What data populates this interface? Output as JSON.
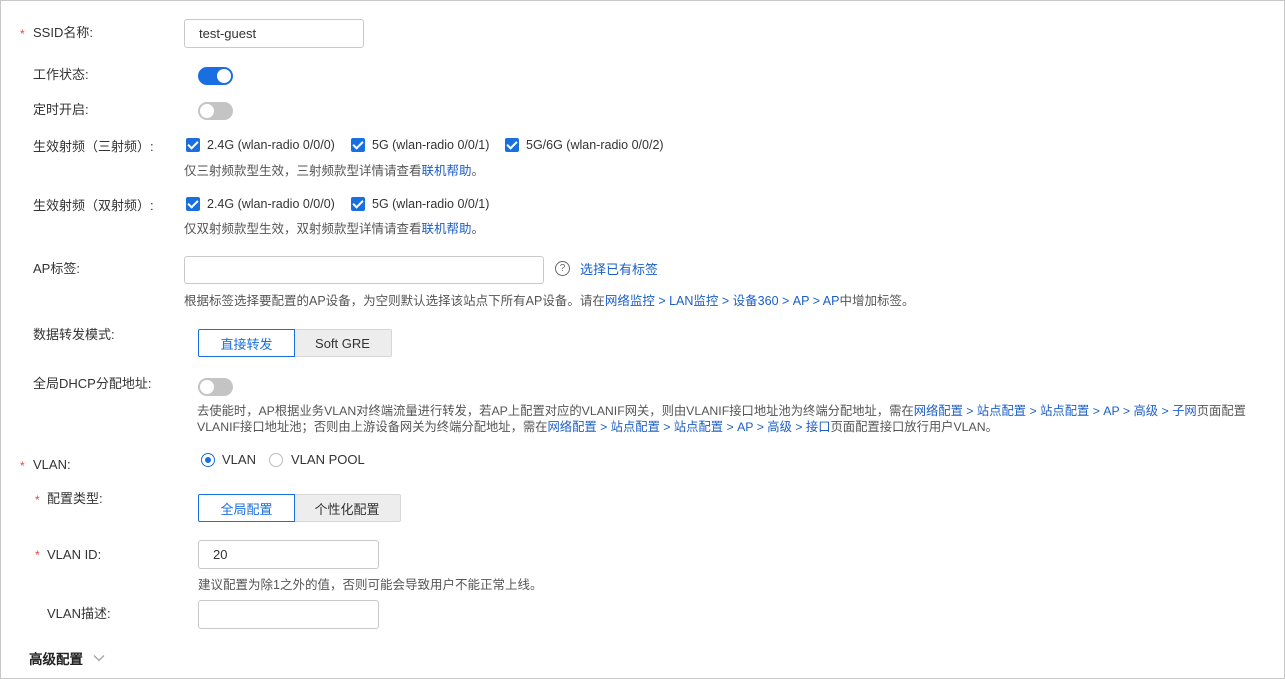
{
  "colors": {
    "accent": "#1a6fe0",
    "link": "#1a5ec7",
    "required": "#e54545"
  },
  "ssid": {
    "label": "SSID名称:",
    "value": "test-guest"
  },
  "work_status": {
    "label": "工作状态:",
    "on": true
  },
  "scheduled": {
    "label": "定时开启:",
    "on": false
  },
  "radio_tri": {
    "label": "生效射频（三射频）:",
    "options": [
      "2.4G (wlan-radio 0/0/0)",
      "5G (wlan-radio 0/0/1)",
      "5G/6G (wlan-radio 0/0/2)"
    ],
    "hint_prefix": "仅三射频款型生效，三射频款型详情请查看",
    "hint_link": "联机帮助",
    "hint_suffix": "。"
  },
  "radio_dual": {
    "label": "生效射频（双射频）:",
    "options": [
      "2.4G (wlan-radio 0/0/0)",
      "5G (wlan-radio 0/0/1)"
    ],
    "hint_prefix": "仅双射频款型生效，双射频款型详情请查看",
    "hint_link": "联机帮助",
    "hint_suffix": "。"
  },
  "ap_tag": {
    "label": "AP标签:",
    "value": "",
    "help_icon": "question-circle-icon",
    "select_link": "选择已有标签",
    "hint_prefix": "根据标签选择要配置的AP设备，为空则默认选择该站点下所有AP设备。请在",
    "hint_link": "网络监控 > LAN监控 > 设备360 > AP > AP",
    "hint_suffix": "中增加标签。"
  },
  "forward_mode": {
    "label": "数据转发模式:",
    "options": [
      "直接转发",
      "Soft GRE"
    ],
    "selected": "直接转发"
  },
  "dhcp": {
    "label": "全局DHCP分配地址:",
    "on": false,
    "line1_prefix": "去使能时，AP根据业务VLAN对终端流量进行转发，若AP上配置对应的VLANIF网关，则由VLANIF接口地址池为终端分配地址，需在",
    "line1_link": "网络配置 > 站点配置 > 站点配置 > AP > 高级 > 子网",
    "line1_suffix": "页面配置",
    "line2_prefix": "VLANIF接口地址池；否则由上游设备网关为终端分配地址，需在",
    "line2_link": "网络配置 > 站点配置 > 站点配置 > AP > 高级 > 接口",
    "line2_suffix": "页面配置接口放行用户VLAN。"
  },
  "vlan": {
    "label": "VLAN:",
    "options": [
      "VLAN",
      "VLAN POOL"
    ],
    "selected": "VLAN"
  },
  "config_type": {
    "label": "配置类型:",
    "options": [
      "全局配置",
      "个性化配置"
    ],
    "selected": "全局配置"
  },
  "vlan_id": {
    "label": "VLAN ID:",
    "value": "20",
    "hint": "建议配置为除1之外的值，否则可能会导致用户不能正常上线。"
  },
  "vlan_desc": {
    "label": "VLAN描述:",
    "value": ""
  },
  "advanced": {
    "label": "高级配置",
    "icon": "chevron-down-icon"
  }
}
